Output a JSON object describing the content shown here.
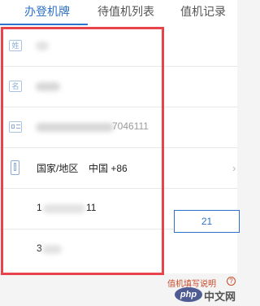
{
  "tabs": [
    {
      "label": "办登机牌",
      "active": true
    },
    {
      "label": "待值机列表",
      "active": false
    },
    {
      "label": "值机记录",
      "active": false
    }
  ],
  "form": {
    "surname": {
      "icon": "name-icon",
      "icon_text": "姓"
    },
    "given_name": {
      "icon": "name-icon",
      "icon_text": "名"
    },
    "id_number": {
      "icon": "id-card-icon",
      "value_visible": "7046111"
    },
    "country": {
      "icon": "phone-icon",
      "label": "国家/地区",
      "value": "中国 +86"
    },
    "phone": {
      "value_prefix": "1",
      "value_suffix": "11"
    },
    "code": {
      "value_prefix": "3",
      "button_label": "21"
    }
  },
  "footer": {
    "help_link": "值机填写说明",
    "help_icon_text": "?"
  },
  "watermark": {
    "php_badge": "php",
    "site_text": "中文网"
  },
  "colors": {
    "accent": "#2d72c8",
    "highlight_border": "#e8444c",
    "link": "#c84a2a"
  }
}
